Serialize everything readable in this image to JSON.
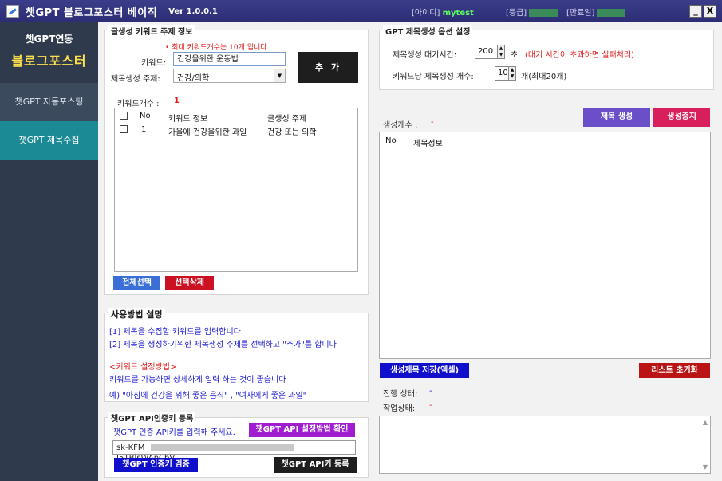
{
  "titlebar": {
    "title": "챗GPT 블로그포스터 베이직",
    "version": "Ver 1.0.0.1",
    "id_label": "[아이디]",
    "id_value": "mytest",
    "grade_label": "[등급]",
    "expiry_label": "[만료일]",
    "minimize": "_",
    "close": "X"
  },
  "sidebar": {
    "brand_line1": "챗GPT연동",
    "brand_line2": "블로그포스터",
    "items": [
      {
        "label": "챗GPT 자동포스팅"
      },
      {
        "label": "챗GPT 제목수집"
      }
    ]
  },
  "keyword_panel": {
    "legend": "글생성 키워드 주제 정보",
    "max_notice": "• 최대 키워드개수는 10개 입니다",
    "keyword_label": "키워드:",
    "keyword_value": "건강을위한 운동법",
    "topic_label": "제목생성 주제:",
    "topic_value": "건강/의학",
    "add_button": "추 가",
    "count_label": "키워드개수 :",
    "count_value": "1",
    "columns": [
      "No",
      "키워드 정보",
      "글생성 주제"
    ],
    "rows": [
      {
        "no": "1",
        "keyword": "가을에 건강을위한 과일",
        "topic": "건강 또는 의학"
      }
    ],
    "select_all": "전체선택",
    "delete_selected": "선택삭제"
  },
  "usage_panel": {
    "legend": "사용방법 설명",
    "line1": "[1] 제목을 수집할 키워드를 입력합니다",
    "line2": "[2] 제목을 생성하기위한 제목생성 주제를 선택하고 \"추가\"를 합니다",
    "tip_title": "<키워드 설정방법>",
    "tip_line1": "키워드를 가능하면 상세하게 입력 하는 것이 좋습니다",
    "tip_line2": "예) \"아침에 건강을 위해 좋은 음식\" , \"여자에게 좋은 과일\""
  },
  "api_panel": {
    "legend": "챗GPT API인증키 등록",
    "prompt": "챗GPT 인증 API키를 입력해 주세요.",
    "guide_button": "챗GPT API 설정방법 확인",
    "key_prefix": "sk-KFM",
    "key_suffix": "J51BlsWAnCbV",
    "verify_button": "챗GPT 인증키 검증",
    "register_button": "챗GPT API키 등록"
  },
  "gpt_options": {
    "legend": "GPT 제목생성 옵션 설정",
    "wait_label": "제목생성 대기시간:",
    "wait_value": "200",
    "wait_unit": "초",
    "wait_note": "(대기 시간이 초과하면 실패처리)",
    "per_keyword_label": "키워드당 제목생성 개수:",
    "per_keyword_value": "10",
    "per_keyword_note": "개(최대20개)"
  },
  "results": {
    "count_label": "생성개수 :",
    "count_value": "-",
    "generate_button": "제목 생성",
    "stop_button": "생성중지",
    "columns": [
      "No",
      "제목정보"
    ],
    "save_button": "생성제목 저장(엑셀)",
    "reset_button": "리스트 초기화",
    "progress_label": "진행 상태:",
    "progress_value": "-",
    "work_label": "작업상태:",
    "work_value": "-"
  },
  "colors": {
    "title_bg": "#2c2d74",
    "sidebar_bg": "#2f3b4c",
    "sidebar_active": "#1c8a95",
    "brand_yellow": "#ffe14d",
    "btn_blue": "#3a6fd8",
    "btn_red": "#cc1122",
    "btn_purple": "#6a4fc9",
    "btn_magenta": "#d81e5b",
    "btn_navy": "#1010cc",
    "btn_dark": "#1e1e1e",
    "btn_darkred": "#bb1414",
    "btn_violet": "#a01ecf"
  }
}
